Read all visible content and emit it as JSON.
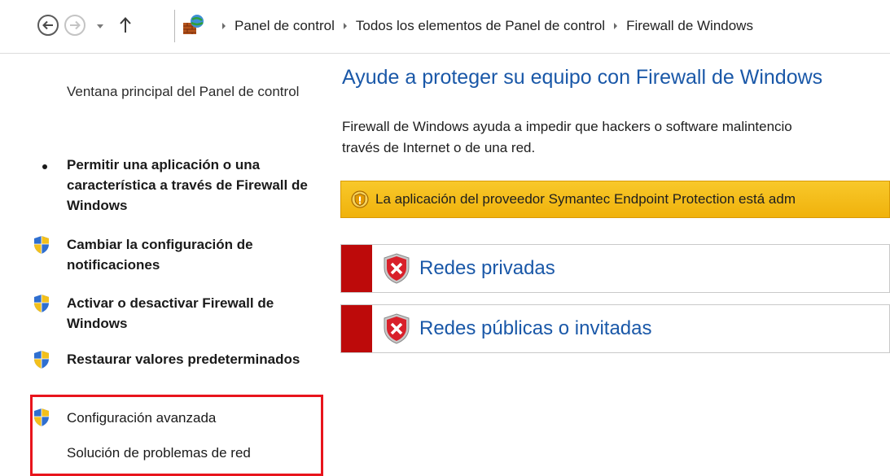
{
  "breadcrumb": {
    "items": [
      {
        "label": "Panel de control"
      },
      {
        "label": "Todos los elementos de Panel de control"
      },
      {
        "label": "Firewall de Windows"
      }
    ]
  },
  "icons": {
    "back": "back-arrow-icon",
    "forward": "forward-arrow-icon",
    "history": "chevron-down-icon",
    "up": "up-arrow-icon",
    "location": "control-panel-icon",
    "task_shield": "uac-shield-icon",
    "warning": "warning-shield-icon",
    "network": "red-x-shield-icon"
  },
  "leftpane": {
    "home_link": "Ventana principal del Panel de control",
    "tasks": [
      {
        "label": "Permitir una aplicación o una característica a través de Firewall de Windows"
      },
      {
        "label": "Cambiar la configuración de notificaciones"
      },
      {
        "label": "Activar o desactivar Firewall de Windows"
      },
      {
        "label": "Restaurar valores predeterminados"
      },
      {
        "label": "Configuración avanzada"
      },
      {
        "label": "Solución de problemas de red"
      }
    ]
  },
  "main": {
    "title": "Ayude a proteger su equipo con Firewall de Windows",
    "description_line1": "Firewall de Windows ayuda a impedir que hackers o software malintencio",
    "description_line2": "través de Internet o de una red.",
    "warning_text": "La aplicación del proveedor Symantec Endpoint Protection está adm",
    "networks": [
      {
        "label": "Redes privadas"
      },
      {
        "label": "Redes públicas o invitadas"
      }
    ]
  },
  "colors": {
    "link_blue": "#1a58a8",
    "warning_yellow": "#f5be1a",
    "status_red": "#bd0a0a",
    "highlight_red": "#e8141c"
  }
}
